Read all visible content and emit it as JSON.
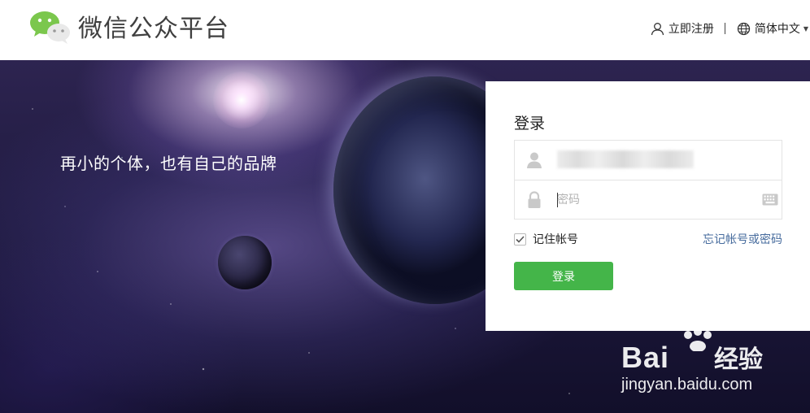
{
  "header": {
    "logo_text": "微信公众平台",
    "register_label": "立即注册",
    "language_label": "简体中文"
  },
  "banner": {
    "slogan": "再小的个体，也有自己的品牌"
  },
  "login": {
    "title": "登录",
    "password_placeholder": "密码",
    "remember_label": "记住帐号",
    "remember_checked": true,
    "forgot_label": "忘记帐号或密码",
    "submit_label": "登录"
  },
  "watermark": {
    "brand": "Bai",
    "brand_suffix": "经验",
    "url": "jingyan.baidu.com"
  },
  "colors": {
    "brand_green": "#44b549",
    "link_blue": "#466b9d",
    "logo_green": "#7bc74d"
  },
  "icons": {
    "logo": "wechat-logo-icon",
    "register": "user-icon",
    "language": "globe-icon",
    "account": "user-icon",
    "password": "lock-icon",
    "keyboard": "keyboard-icon"
  }
}
